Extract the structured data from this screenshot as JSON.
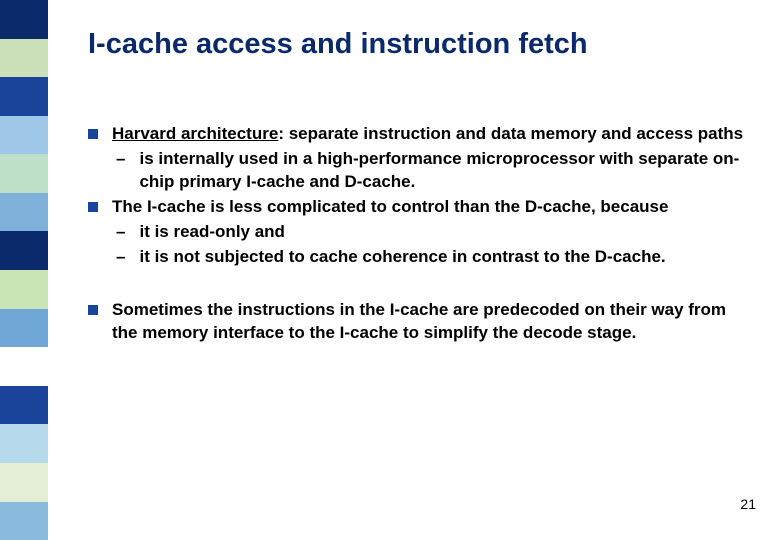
{
  "title": "I-cache access and instruction fetch",
  "bullets": [
    {
      "underlined": "Harvard architecture",
      "rest": ": separate instruction and data memory and access paths",
      "subs": [
        "is internally used in a high-performance microprocessor with separate on-chip primary I-cache and D-cache."
      ]
    },
    {
      "text": "The I-cache is less complicated to control than the D-cache, because",
      "subs": [
        "it is read-only and",
        "it is not subjected to cache coherence in contrast to the D-cache."
      ]
    },
    {
      "text": "Sometimes the instructions in the I-cache are predecoded on their way from the memory interface to the I-cache to simplify the decode stage."
    }
  ],
  "pageNumber": "21"
}
